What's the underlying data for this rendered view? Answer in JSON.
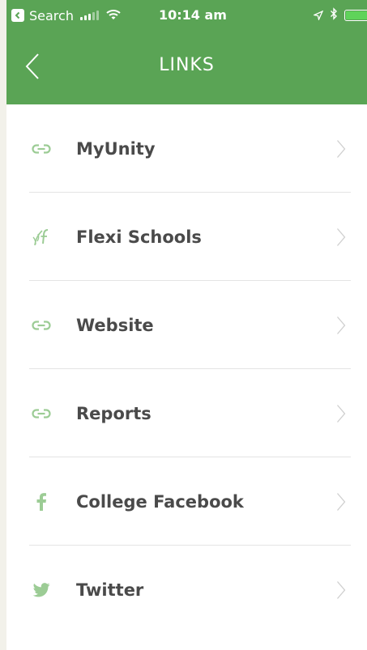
{
  "status_bar": {
    "back_app": "Search",
    "time": "10:14 am",
    "signal_icon": "signal-bars-icon",
    "wifi_icon": "wifi-icon",
    "location_icon": "location-arrow-icon",
    "bluetooth_icon": "bluetooth-icon",
    "battery_icon": "battery-icon",
    "battery_level": 1.0
  },
  "nav": {
    "title": "LINKS",
    "back_icon": "chevron-left-icon"
  },
  "links": [
    {
      "label": "MyUnity",
      "icon": "link-icon"
    },
    {
      "label": "Flexi Schools",
      "icon": "flexi-schools-logo-icon"
    },
    {
      "label": "Website",
      "icon": "link-icon"
    },
    {
      "label": "Reports",
      "icon": "link-icon"
    },
    {
      "label": "College Facebook",
      "icon": "facebook-icon"
    },
    {
      "label": "Twitter",
      "icon": "twitter-icon"
    }
  ],
  "colors": {
    "header_green": "#5aa455",
    "icon_green": "#9ccc95",
    "label_gray": "#4a4a4a",
    "chevron_gray": "#cfcfcf",
    "battery_green": "#5fd35a"
  }
}
